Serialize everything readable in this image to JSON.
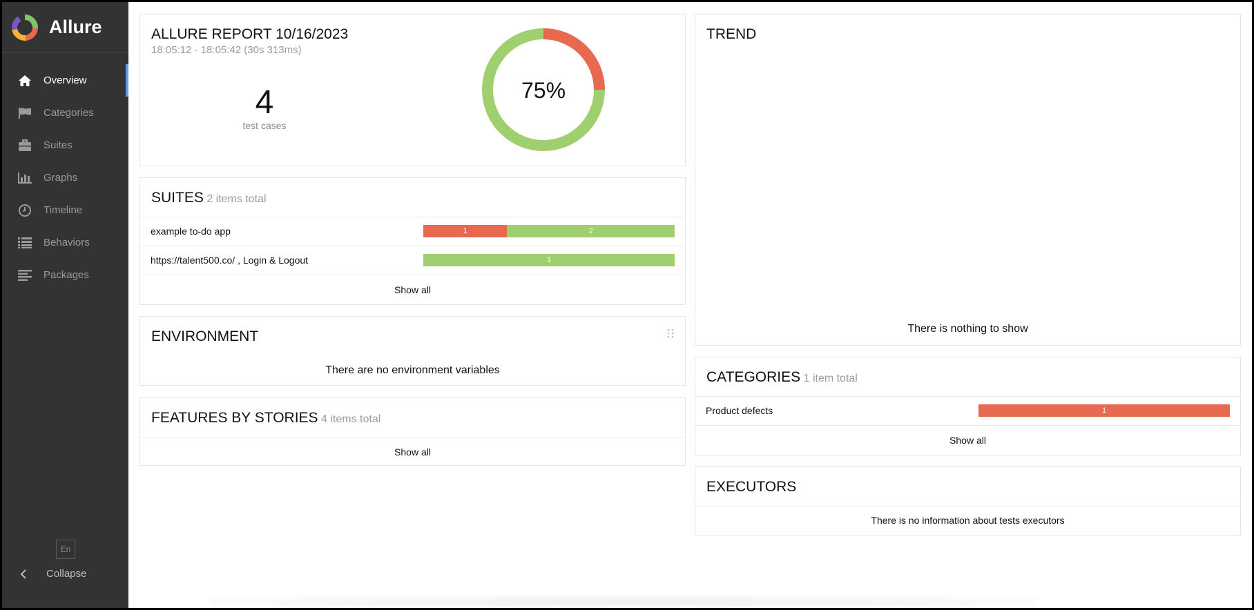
{
  "brand": {
    "name": "Allure"
  },
  "sidebar": {
    "items": [
      {
        "label": "Overview",
        "icon": "home-icon"
      },
      {
        "label": "Categories",
        "icon": "flag-icon"
      },
      {
        "label": "Suites",
        "icon": "briefcase-icon"
      },
      {
        "label": "Graphs",
        "icon": "bar-chart-icon"
      },
      {
        "label": "Timeline",
        "icon": "clock-icon"
      },
      {
        "label": "Behaviors",
        "icon": "list-icon"
      },
      {
        "label": "Packages",
        "icon": "align-left-icon"
      }
    ],
    "active": "Overview",
    "language": "En",
    "collapse_label": "Collapse"
  },
  "summary": {
    "title": "ALLURE REPORT 10/16/2023",
    "time_range": "18:05:12 - 18:05:42 (30s 313ms)",
    "test_count": "4",
    "test_count_label": "test cases",
    "donut": {
      "percent_label": "75%",
      "passed": 3,
      "failed": 1
    }
  },
  "suites": {
    "title": "SUITES",
    "subtitle": "2 items total",
    "rows": [
      {
        "name": "example to-do app",
        "segments": [
          {
            "status": "failed",
            "value": 1,
            "label": "1"
          },
          {
            "status": "passed",
            "value": 2,
            "label": "2"
          }
        ]
      },
      {
        "name": "https://talent500.co/ , Login & Logout",
        "segments": [
          {
            "status": "passed",
            "value": 1,
            "label": "1"
          }
        ]
      }
    ],
    "show_all": "Show all"
  },
  "environment": {
    "title": "ENVIRONMENT",
    "message": "There are no environment variables"
  },
  "features": {
    "title": "FEATURES BY STORIES",
    "subtitle": "4 items total",
    "show_all": "Show all"
  },
  "trend": {
    "title": "TREND",
    "message": "There is nothing to show"
  },
  "categories": {
    "title": "CATEGORIES",
    "subtitle": "1 item total",
    "rows": [
      {
        "name": "Product defects",
        "segments": [
          {
            "status": "failed",
            "value": 1,
            "label": "1"
          }
        ]
      }
    ],
    "show_all": "Show all"
  },
  "executors": {
    "title": "EXECUTORS",
    "message": "There is no information about tests executors"
  },
  "colors": {
    "failed": "#e8694f",
    "passed": "#9fcf6e",
    "sidebar": "#333333",
    "accent": "#5aa0e6"
  }
}
